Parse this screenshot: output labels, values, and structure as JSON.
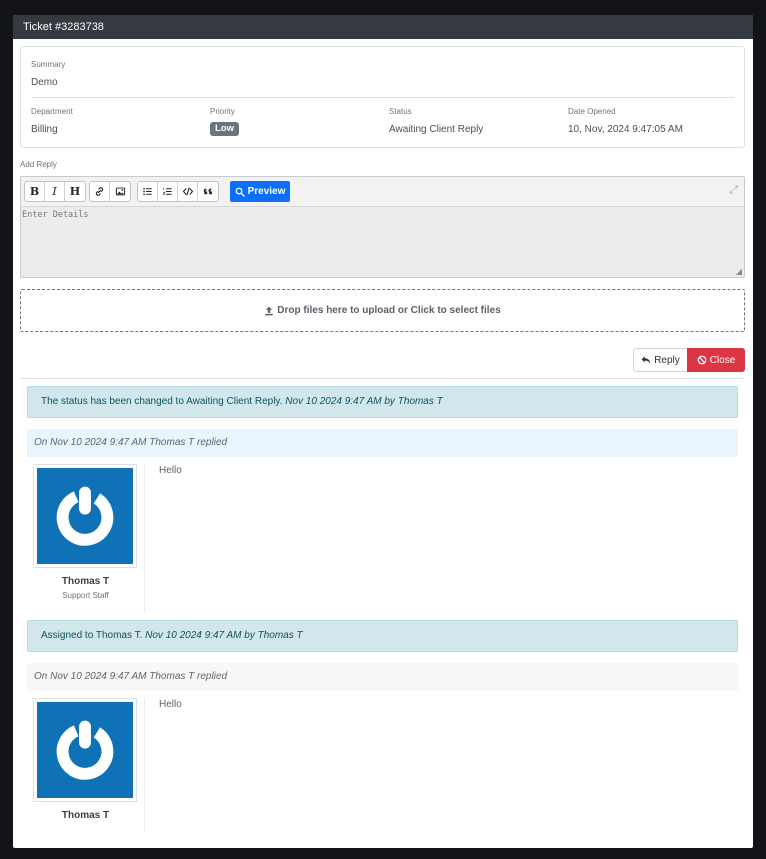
{
  "modal": {
    "title": "Ticket #3283738"
  },
  "summary": {
    "label": "Summary",
    "value": "Demo"
  },
  "department": {
    "label": "Department",
    "value": "Billing"
  },
  "priority": {
    "label": "Priority",
    "value": "Low"
  },
  "status": {
    "label": "Status",
    "value": "Awaiting Client Reply"
  },
  "date_opened": {
    "label": "Date Opened",
    "value": "10, Nov, 2024 9:47:05 AM"
  },
  "add_reply": {
    "label": "Add Reply",
    "placeholder": "Enter Details",
    "toolbar": {
      "bold": "B",
      "italic": "I",
      "heading": "H",
      "preview_label": "Preview"
    }
  },
  "dropzone": {
    "text": "Drop files here to upload or Click to select files"
  },
  "actions": {
    "reply_label": "Reply",
    "close_label": "Close"
  },
  "timeline": {
    "alert1": {
      "text": "The status has been changed to Awaiting Client Reply.",
      "meta": "Nov 10 2024 9:47 AM by Thomas T"
    },
    "reply1": {
      "header": "On Nov 10 2024 9:47 AM Thomas T replied",
      "author": "Thomas T",
      "role": "Support Staff",
      "message": "Hello"
    },
    "alert2": {
      "text": "Assigned to Thomas T.",
      "meta": "Nov 10 2024 9:47 AM by Thomas T"
    },
    "reply2": {
      "header": "On Nov 10 2024 9:47 AM Thomas T replied",
      "author": "Thomas T",
      "message": "Hello"
    }
  },
  "colors": {
    "header_bg": "#343a40",
    "primary": "#0d6efd",
    "danger": "#dc3545",
    "info_bg": "#d1e7eb",
    "avatar_bg": "#0f72b6",
    "badge": "#6c757d"
  }
}
